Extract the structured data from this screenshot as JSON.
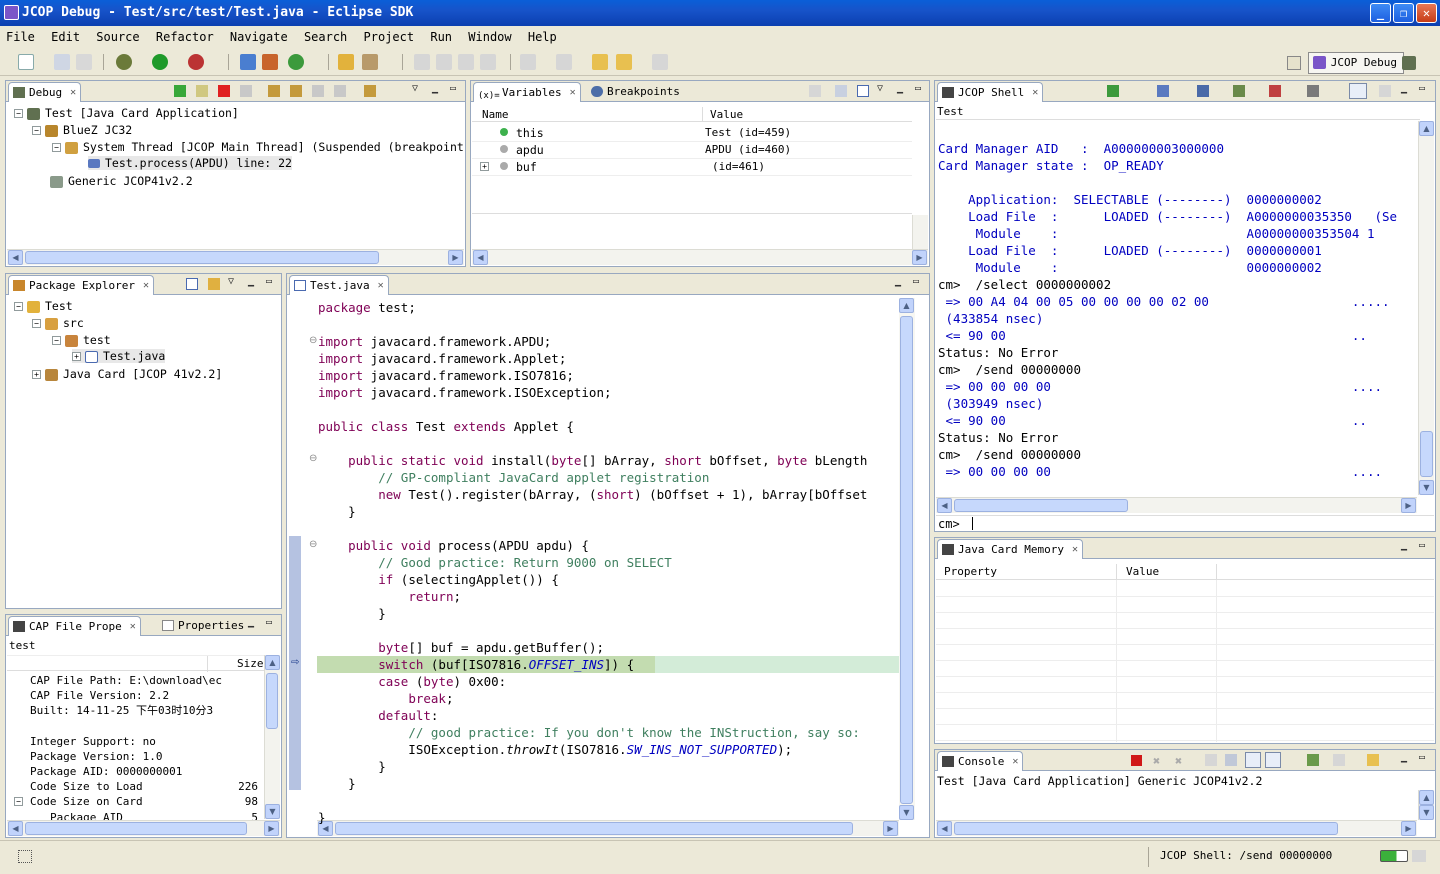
{
  "window": {
    "title": "JCOP Debug - Test/src/test/Test.java - Eclipse SDK"
  },
  "menu": [
    "File",
    "Edit",
    "Source",
    "Refactor",
    "Navigate",
    "Search",
    "Project",
    "Run",
    "Window",
    "Help"
  ],
  "perspective": {
    "label": "JCOP Debug"
  },
  "debug": {
    "tab": "Debug",
    "tree": [
      "Test [Java Card Application]",
      "BlueZ JC32",
      "System Thread [JCOP Main Thread] (Suspended (breakpoint at line",
      "Test.process(APDU) line: 22",
      "Generic JCOP41v2.2"
    ]
  },
  "variables": {
    "tabs": [
      "Variables",
      "Breakpoints"
    ],
    "columns": [
      "Name",
      "Value"
    ],
    "rows": [
      {
        "name": "this",
        "value": "Test  (id=459)"
      },
      {
        "name": "apdu",
        "value": "APDU  (id=460)"
      },
      {
        "name": "buf",
        "value": "(id=461)"
      }
    ]
  },
  "package_explorer": {
    "tab": "Package Explorer",
    "tree": [
      "Test",
      "src",
      "test",
      "Test.java",
      "Java Card [JCOP 41v2.2]"
    ]
  },
  "cap": {
    "tabs": [
      "CAP File Prope",
      "Properties"
    ],
    "header": "test",
    "size_col": "Size",
    "rows": [
      {
        "label": "CAP File Path: E:\\download\\ec",
        "size": ""
      },
      {
        "label": "CAP File Version: 2.2",
        "size": ""
      },
      {
        "label": "Built: 14-11-25 下午03时10分3",
        "size": ""
      },
      {
        "label": "",
        "size": ""
      },
      {
        "label": "Integer Support: no",
        "size": ""
      },
      {
        "label": "Package Version: 1.0",
        "size": ""
      },
      {
        "label": "Package AID: 0000000001",
        "size": ""
      },
      {
        "label": "Code Size to Load",
        "size": "226"
      },
      {
        "label": "Code Size on Card",
        "size": "98"
      },
      {
        "label": "Package AID",
        "size": "5"
      }
    ]
  },
  "editor": {
    "tab": "Test.java",
    "lines": [
      "package test;",
      "",
      "import javacard.framework.APDU;",
      "import javacard.framework.Applet;",
      "import javacard.framework.ISO7816;",
      "import javacard.framework.ISOException;",
      "",
      "public class Test extends Applet {",
      "",
      "    public static void install(byte[] bArray, short bOffset, byte bLength",
      "        // GP-compliant JavaCard applet registration",
      "        new Test().register(bArray, (short) (bOffset + 1), bArray[bOffset",
      "    }",
      "",
      "    public void process(APDU apdu) {",
      "        // Good practice: Return 9000 on SELECT",
      "        if (selectingApplet()) {",
      "            return;",
      "        }",
      "",
      "        byte[] buf = apdu.getBuffer();",
      "        switch (buf[ISO7816.OFFSET_INS]) {",
      "        case (byte) 0x00:",
      "            break;",
      "        default:",
      "            // good practice: If you don't know the INStruction, say so:",
      "            ISOException.throwIt(ISO7816.SW_INS_NOT_SUPPORTED);",
      "        }",
      "    }",
      "",
      "}"
    ]
  },
  "shell": {
    "tab": "JCOP Shell",
    "header": "Test",
    "lines": [
      "",
      "Card Manager AID   :  A000000003000000",
      "Card Manager state :  OP_READY",
      "",
      "    Application:  SELECTABLE (--------)  0000000002",
      "    Load File  :      LOADED (--------)  A0000000035350   (Se",
      "     Module    :                         A00000000353504 1",
      "    Load File  :      LOADED (--------)  0000000001",
      "     Module    :                         0000000002",
      "cm>  /select 0000000002",
      " => 00 A4 04 00 05 00 00 00 00 02 00                   .....",
      " (433854 nsec)",
      " <= 90 00                                              ..",
      "Status: No Error",
      "cm>  /send 00000000",
      " => 00 00 00 00                                        ....",
      " (303949 nsec)",
      " <= 90 00                                              ..",
      "Status: No Error",
      "cm>  /send 00000000",
      " => 00 00 00 00                                        ...."
    ],
    "prompt": "cm>"
  },
  "memory": {
    "tab": "Java Card Memory",
    "columns": [
      "Property",
      "Value"
    ]
  },
  "console": {
    "tab": "Console",
    "text": "Test [Java Card Application] Generic JCOP41v2.2"
  },
  "status": {
    "message": "JCOP Shell: /send 00000000"
  }
}
